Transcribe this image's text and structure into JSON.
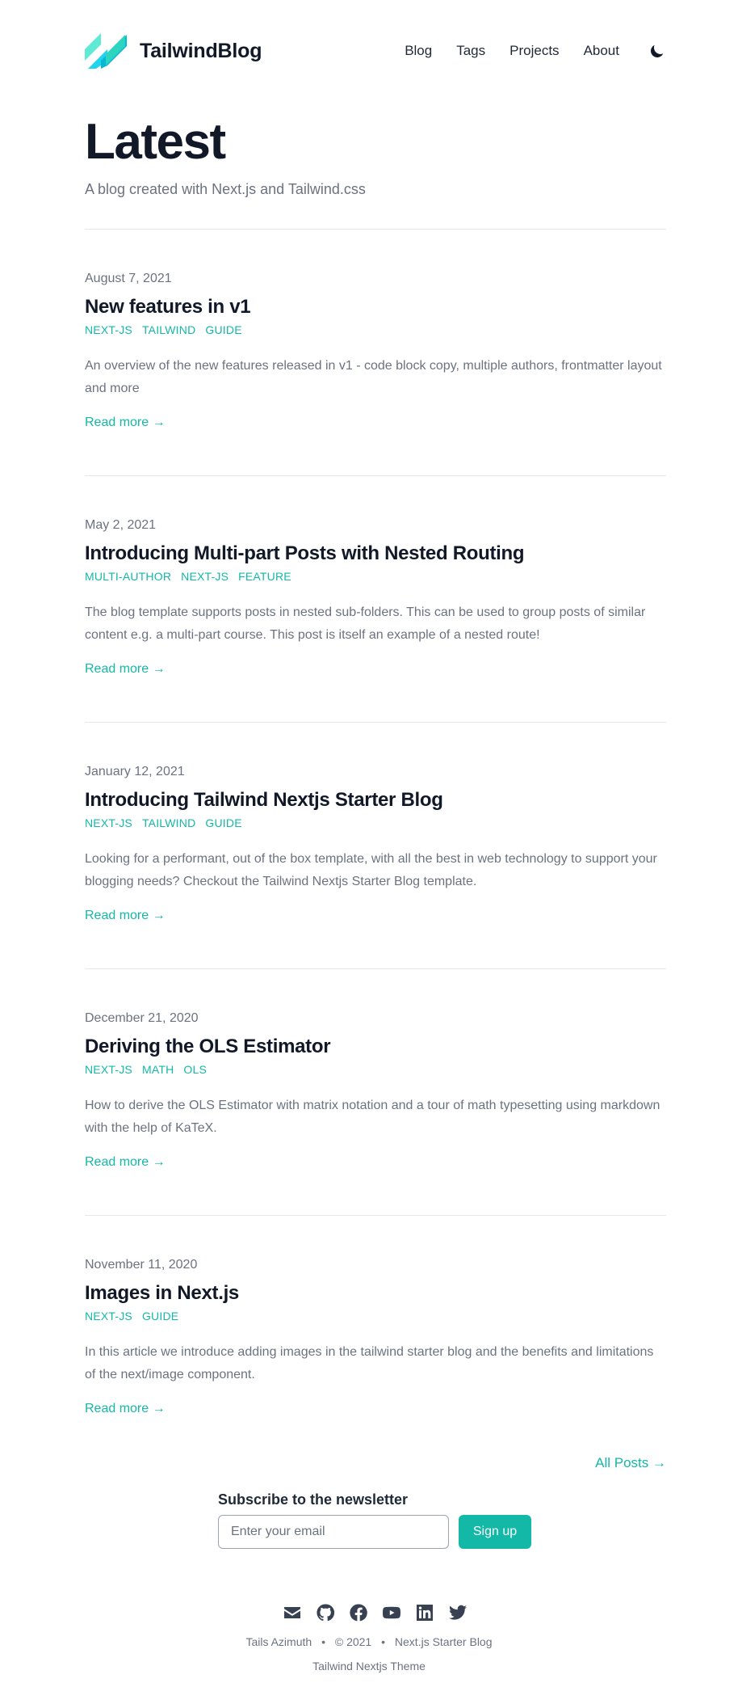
{
  "header": {
    "brand": "TailwindBlog",
    "nav": [
      "Blog",
      "Tags",
      "Projects",
      "About"
    ],
    "theme_icon": "moon-icon"
  },
  "hero": {
    "title": "Latest",
    "subtitle": "A blog created with Next.js and Tailwind.css"
  },
  "posts": [
    {
      "date": "August 7, 2021",
      "title": "New features in v1",
      "tags": [
        "NEXT-JS",
        "TAILWIND",
        "GUIDE"
      ],
      "summary": "An overview of the new features released in v1 - code block copy, multiple authors, frontmatter layout and more",
      "read_more": "Read more →"
    },
    {
      "date": "May 2, 2021",
      "title": "Introducing Multi-part Posts with Nested Routing",
      "tags": [
        "MULTI-AUTHOR",
        "NEXT-JS",
        "FEATURE"
      ],
      "summary": "The blog template supports posts in nested sub-folders. This can be used to group posts of similar content e.g. a multi-part course. This post is itself an example of a nested route!",
      "read_more": "Read more →"
    },
    {
      "date": "January 12, 2021",
      "title": "Introducing Tailwind Nextjs Starter Blog",
      "tags": [
        "NEXT-JS",
        "TAILWIND",
        "GUIDE"
      ],
      "summary": "Looking for a performant, out of the box template, with all the best in web technology to support your blogging needs? Checkout the Tailwind Nextjs Starter Blog template.",
      "read_more": "Read more →"
    },
    {
      "date": "December 21, 2020",
      "title": "Deriving the OLS Estimator",
      "tags": [
        "NEXT-JS",
        "MATH",
        "OLS"
      ],
      "summary": "How to derive the OLS Estimator with matrix notation and a tour of math typesetting using markdown with the help of KaTeX.",
      "read_more": "Read more →"
    },
    {
      "date": "November 11, 2020",
      "title": "Images in Next.js",
      "tags": [
        "NEXT-JS",
        "GUIDE"
      ],
      "summary": "In this article we introduce adding images in the tailwind starter blog and the benefits and limitations of the next/image component.",
      "read_more": "Read more →"
    }
  ],
  "all_posts": "All Posts →",
  "newsletter": {
    "title": "Subscribe to the newsletter",
    "placeholder": "Enter your email",
    "button": "Sign up"
  },
  "footer": {
    "socials": [
      "mail-icon",
      "github-icon",
      "facebook-icon",
      "youtube-icon",
      "linkedin-icon",
      "twitter-icon"
    ],
    "author": "Tails Azimuth",
    "separator": "•",
    "copyright": "© 2021",
    "site": "Next.js Starter Blog",
    "theme": "Tailwind Nextjs Theme"
  },
  "colors": {
    "accent": "#14b8a6",
    "text": "#111827",
    "muted": "#6b7280",
    "divider": "#e5e7eb"
  }
}
